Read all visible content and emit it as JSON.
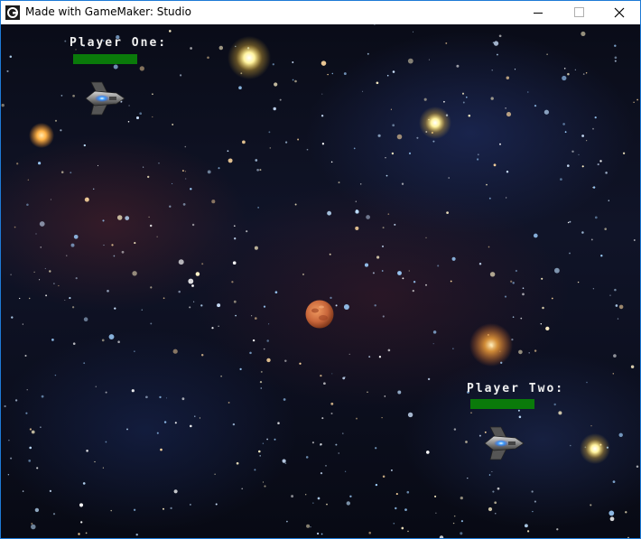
{
  "window": {
    "title": "Made with GameMaker: Studio",
    "accent_color": "#1e7ad6",
    "icons": {
      "app": "gamemaker-icon",
      "minimize": "minimize-icon",
      "maximize": "maximize-icon",
      "close": "close-icon"
    }
  },
  "game": {
    "background": "starfield",
    "players": [
      {
        "label": "Player One:",
        "health_fraction": 1.0,
        "health_color": "#0a7a0a",
        "ship": "spaceship"
      },
      {
        "label": "Player Two:",
        "health_fraction": 1.0,
        "health_color": "#0a7a0a",
        "ship": "spaceship"
      }
    ],
    "planet": {
      "name": "planet",
      "color": "#c8663a"
    }
  }
}
